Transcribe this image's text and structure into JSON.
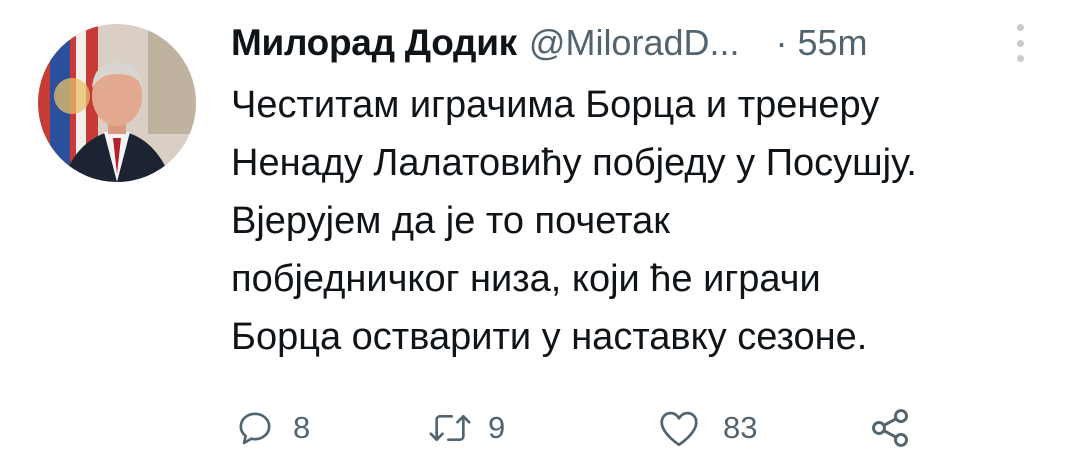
{
  "tweet": {
    "author": {
      "display_name": "Милорад Додик",
      "handle": "@MiloradD..."
    },
    "separator": "·",
    "timestamp": "55m",
    "body_lines": [
      "Честитам играчима Борца и тренеру",
      "Ненаду Лалатовићу побједу у Посушју.",
      "Вјерујем да је то почетак",
      "побједничког низа, који ће играчи",
      "Борца остварити у наставку сезоне."
    ],
    "actions": {
      "reply": {
        "icon": "reply-icon",
        "count": "8"
      },
      "retweet": {
        "icon": "retweet-icon",
        "count": "9"
      },
      "like": {
        "icon": "heart-icon",
        "count": "83"
      },
      "share": {
        "icon": "share-icon"
      }
    }
  },
  "colors": {
    "text_primary": "#0f1419",
    "text_secondary": "#536471",
    "background": "#ffffff"
  }
}
